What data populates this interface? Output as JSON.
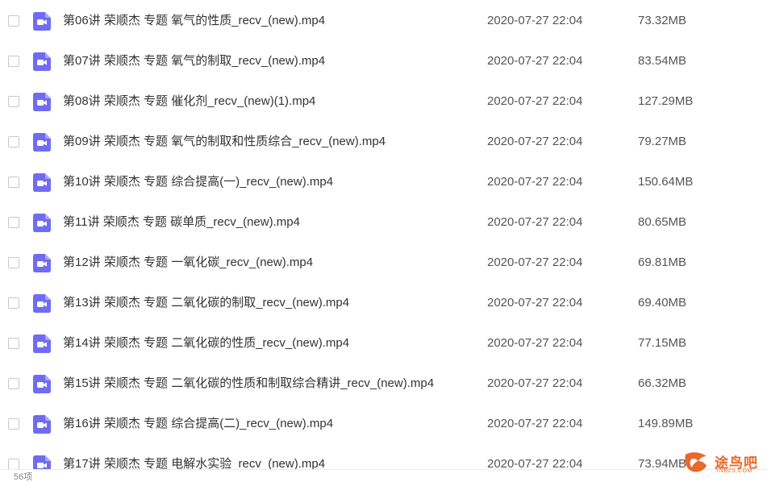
{
  "colors": {
    "file_icon": "#6f6cf2",
    "text": "#333333",
    "muted": "#555555",
    "watermark": "#e8682a"
  },
  "icons": {
    "checkbox": "checkbox-unchecked",
    "file": "video-file-icon"
  },
  "files": [
    {
      "name": "第06讲 荣顺杰 专题 氧气的性质_recv_(new).mp4",
      "date": "2020-07-27 22:04",
      "size": "73.32MB"
    },
    {
      "name": "第07讲 荣顺杰 专题 氧气的制取_recv_(new).mp4",
      "date": "2020-07-27 22:04",
      "size": "83.54MB"
    },
    {
      "name": "第08讲 荣顺杰 专题 催化剂_recv_(new)(1).mp4",
      "date": "2020-07-27 22:04",
      "size": "127.29MB"
    },
    {
      "name": "第09讲 荣顺杰 专题 氧气的制取和性质综合_recv_(new).mp4",
      "date": "2020-07-27 22:04",
      "size": "79.27MB"
    },
    {
      "name": "第10讲 荣顺杰 专题 综合提高(一)_recv_(new).mp4",
      "date": "2020-07-27 22:04",
      "size": "150.64MB"
    },
    {
      "name": "第11讲 荣顺杰 专题 碳单质_recv_(new).mp4",
      "date": "2020-07-27 22:04",
      "size": "80.65MB"
    },
    {
      "name": "第12讲 荣顺杰 专题 一氧化碳_recv_(new).mp4",
      "date": "2020-07-27 22:04",
      "size": "69.81MB"
    },
    {
      "name": "第13讲 荣顺杰 专题 二氧化碳的制取_recv_(new).mp4",
      "date": "2020-07-27 22:04",
      "size": "69.40MB"
    },
    {
      "name": "第14讲 荣顺杰 专题 二氧化碳的性质_recv_(new).mp4",
      "date": "2020-07-27 22:04",
      "size": "77.15MB"
    },
    {
      "name": "第15讲 荣顺杰 专题 二氧化碳的性质和制取综合精讲_recv_(new).mp4",
      "date": "2020-07-27 22:04",
      "size": "66.32MB"
    },
    {
      "name": "第16讲 荣顺杰 专题 综合提高(二)_recv_(new).mp4",
      "date": "2020-07-27 22:04",
      "size": "149.89MB"
    },
    {
      "name": "第17讲 荣顺杰 专题 电解水实验_recv_(new).mp4",
      "date": "2020-07-27 22:04",
      "size": "73.94MB"
    }
  ],
  "footer": {
    "count": "56项"
  },
  "watermark": {
    "name": "途鸟吧",
    "domain": "TNBZS.COM"
  }
}
